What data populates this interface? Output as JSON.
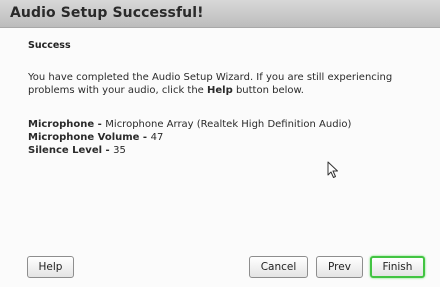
{
  "window": {
    "title": "Audio Setup Successful!"
  },
  "content": {
    "heading": "Success",
    "paragraph_pre": "You have completed the Audio Setup Wizard. If you are still experiencing problems with your audio, click the ",
    "paragraph_bold": "Help",
    "paragraph_post": " button below.",
    "microphone_label": "Microphone - ",
    "microphone_value": "Microphone Array (Realtek High Definition Audio)",
    "volume_label": "Microphone Volume - ",
    "volume_value": "47",
    "silence_label": "Silence Level - ",
    "silence_value": "35"
  },
  "buttons": {
    "help": "Help",
    "cancel": "Cancel",
    "prev": "Prev",
    "finish": "Finish"
  },
  "colors": {
    "finish_focus_border": "#42c442"
  },
  "icons": {
    "cursor": "mouse-pointer-icon"
  }
}
